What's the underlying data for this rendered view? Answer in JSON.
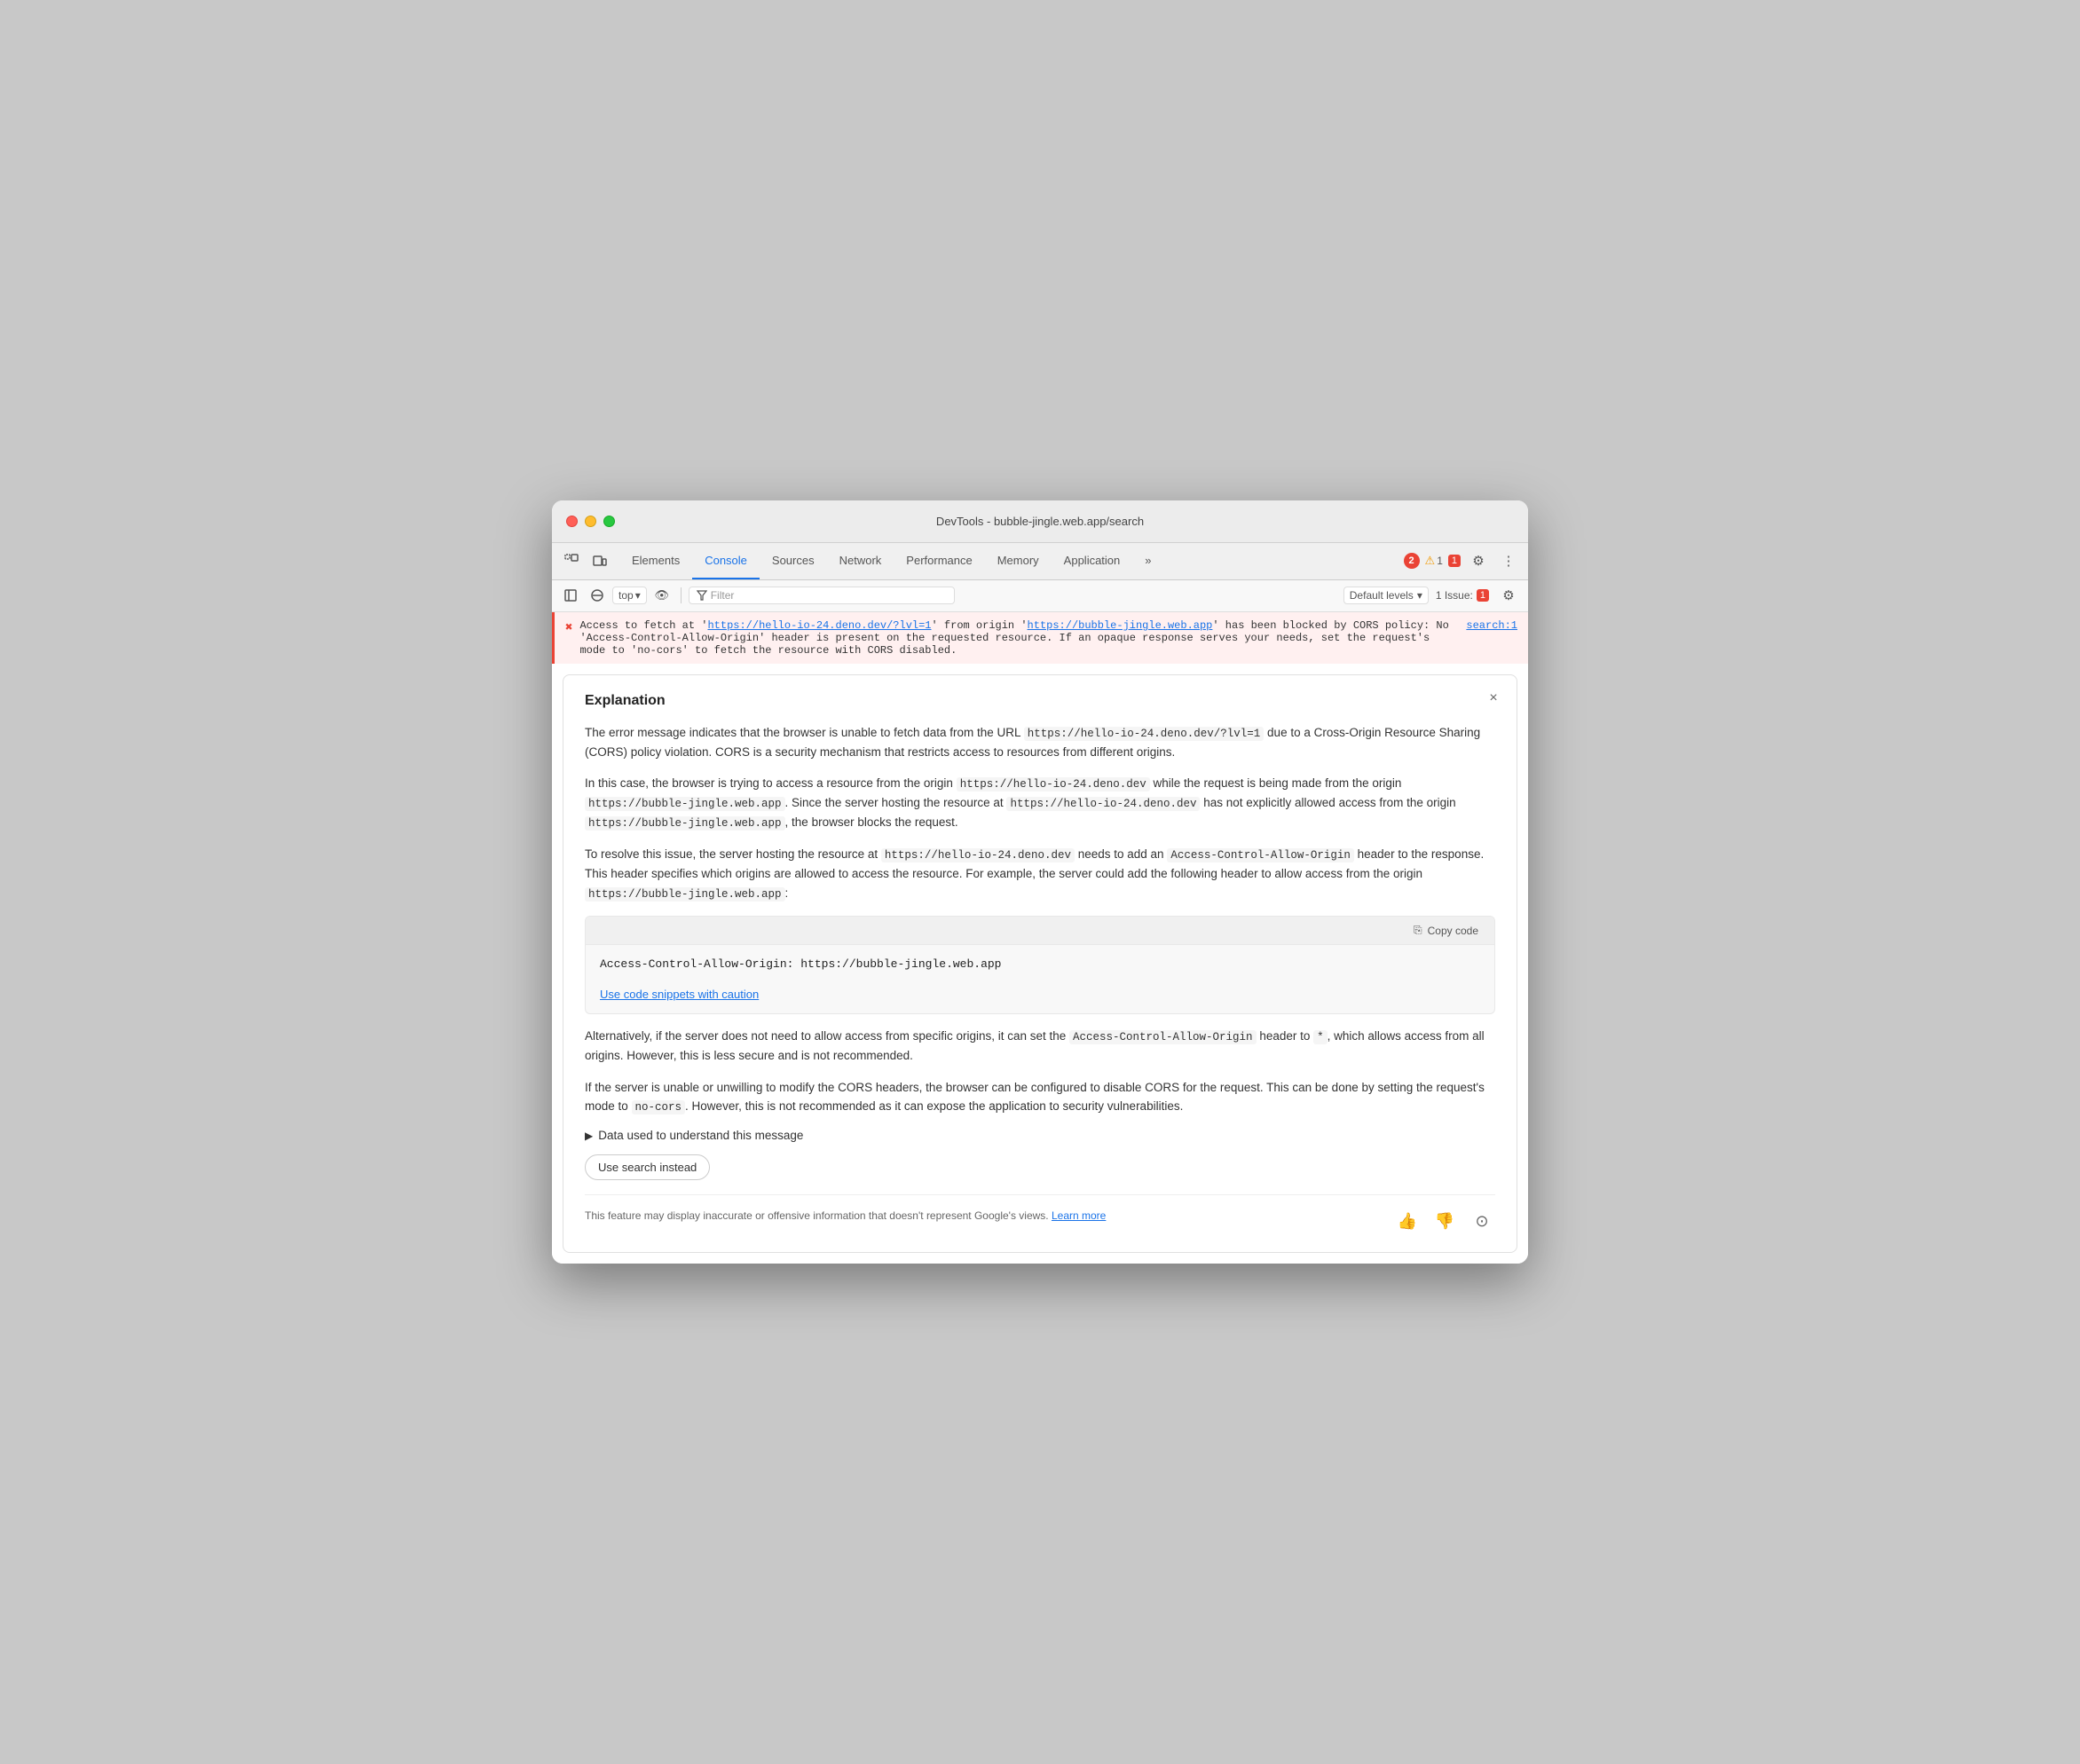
{
  "window": {
    "title": "DevTools - bubble-jingle.web.app/search"
  },
  "tabs": {
    "items": [
      {
        "label": "Elements",
        "active": false
      },
      {
        "label": "Console",
        "active": true
      },
      {
        "label": "Sources",
        "active": false
      },
      {
        "label": "Network",
        "active": false
      },
      {
        "label": "Performance",
        "active": false
      },
      {
        "label": "Memory",
        "active": false
      },
      {
        "label": "Application",
        "active": false
      }
    ],
    "more_label": "»",
    "errors_count": "2",
    "warnings_count": "1",
    "issues_count": "1"
  },
  "toolbar": {
    "top_label": "top",
    "filter_placeholder": "Filter",
    "default_levels_label": "Default levels",
    "issues_label": "1 Issue:"
  },
  "error": {
    "icon": "✖",
    "message_before": "Access to fetch at '",
    "url1": "https://hello-io-24.deno.dev/?lvl=1",
    "message_middle": "' from origin '",
    "url2": "https://bubble-jingle.web.app",
    "message_after": "' has been blocked by CORS policy: No 'Access-Control-Allow-Origin' header is present on the requested resource. If an opaque response serves your needs, set the request's mode to 'no-cors' to fetch the resource with CORS disabled.",
    "source_link": "search:1"
  },
  "explanation": {
    "title": "Explanation",
    "close_label": "×",
    "paragraphs": [
      "The error message indicates that the browser is unable to fetch data from the URL https://hello-io-24.deno.dev/?lvl=1 due to a Cross-Origin Resource Sharing (CORS) policy violation. CORS is a security mechanism that restricts access to resources from different origins.",
      "In this case, the browser is trying to access a resource from the origin https://hello-io-24.deno.dev while the request is being made from the origin https://bubble-jingle.web.app. Since the server hosting the resource at https://hello-io-24.deno.dev has not explicitly allowed access from the origin https://bubble-jingle.web.app, the browser blocks the request.",
      "To resolve this issue, the server hosting the resource at https://hello-io-24.deno.dev needs to add an Access-Control-Allow-Origin header to the response. This header specifies which origins are allowed to access the resource. For example, the server could add the following header to allow access from the origin https://bubble-jingle.web.app:"
    ],
    "code_snippet": "Access-Control-Allow-Origin: https://bubble-jingle.web.app",
    "copy_code_label": "Copy code",
    "caution_link": "Use code snippets with caution",
    "para2": "Alternatively, if the server does not need to allow access from specific origins, it can set the Access-Control-Allow-Origin header to *, which allows access from all origins. However, this is less secure and is not recommended.",
    "para3": "If the server is unable or unwilling to modify the CORS headers, the browser can be configured to disable CORS for the request. This can be done by setting the request's mode to no-cors. However, this is not recommended as it can expose the application to security vulnerabilities.",
    "data_used_label": "Data used to understand this message",
    "use_search_label": "Use search instead",
    "disclaimer": "This feature may display inaccurate or offensive information that doesn't represent Google's views.",
    "learn_more_label": "Learn more"
  }
}
